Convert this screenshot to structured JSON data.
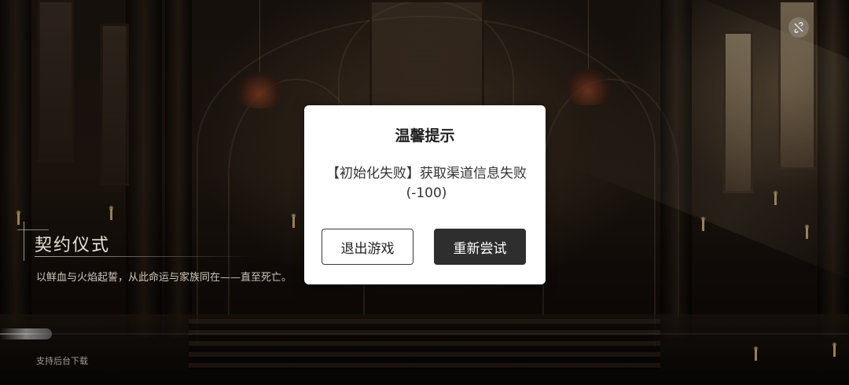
{
  "background": {
    "title": "契约仪式",
    "subtitle": "以鲜血与火焰起誓，从此命运与家族同在——直至死亡。",
    "bg_download_label": "支持后台下载",
    "progress_fraction": 0.06
  },
  "dialog": {
    "title": "温馨提示",
    "message": "【初始化失败】获取渠道信息失败(-100)",
    "exit_button": "退出游戏",
    "retry_button": "重新尝试"
  },
  "icons": {
    "top_right": "link-off-icon"
  },
  "colors": {
    "dialog_bg": "#ffffff",
    "retry_button_bg": "#2e2e2e",
    "exit_button_border": "#3a3a3a"
  }
}
